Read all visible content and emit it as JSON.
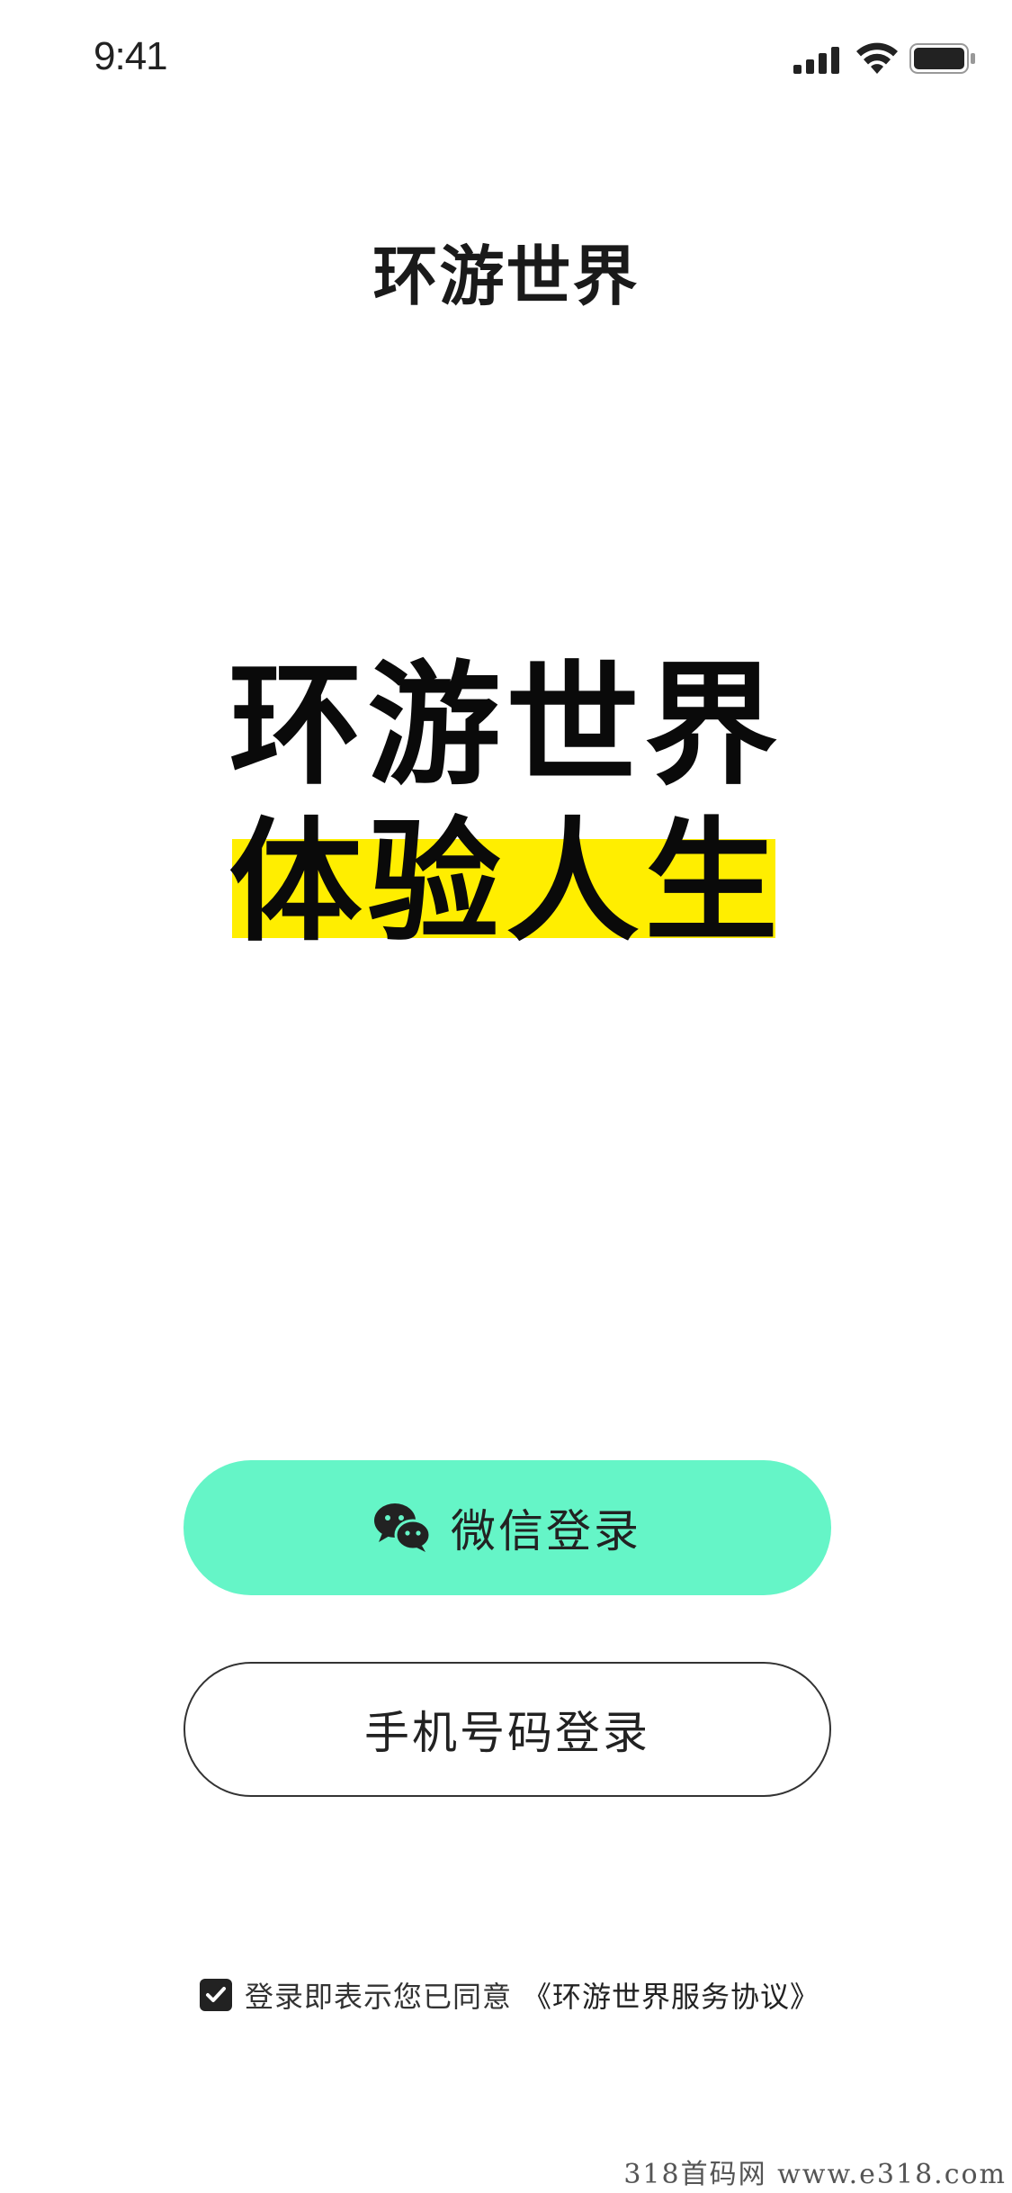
{
  "status_bar": {
    "time": "9:41",
    "icons": [
      "signal-icon",
      "wifi-icon",
      "battery-icon"
    ]
  },
  "logo": {
    "text": "环游世界"
  },
  "hero": {
    "line1": "环游世界",
    "line2": "体验人生",
    "highlight_color": "#ffee00"
  },
  "buttons": {
    "wechat_label": "微信登录",
    "wechat_icon": "wechat-icon",
    "wechat_color": "#65f5c7",
    "phone_label": "手机号码登录"
  },
  "agreement": {
    "checked": true,
    "text": "登录即表示您已同意",
    "link": "《环游世界服务协议》"
  },
  "watermark": {
    "text": "318首码网  www.e318.com"
  }
}
